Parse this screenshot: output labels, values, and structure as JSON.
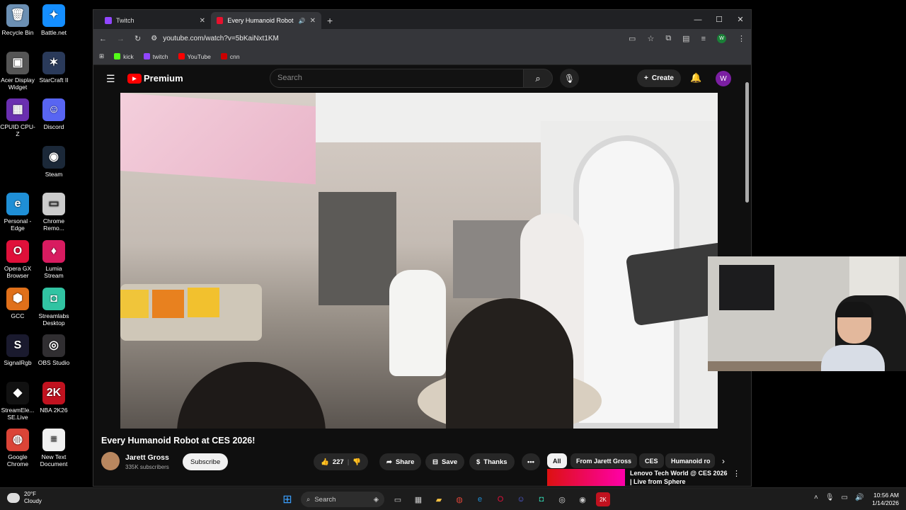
{
  "desktop": {
    "icons": [
      {
        "label": "Recycle Bin",
        "color": "#6b8fb3",
        "glyph": "🗑"
      },
      {
        "label": "Battle.net",
        "color": "#148eff",
        "glyph": "✦"
      },
      {
        "label": "Acer Display Widget",
        "color": "#555555",
        "glyph": "▣"
      },
      {
        "label": "StarCraft II",
        "color": "#2a3a5a",
        "glyph": "✶"
      },
      {
        "label": "CPUID CPU-Z",
        "color": "#6a2fb0",
        "glyph": "▦"
      },
      {
        "label": "Discord",
        "color": "#5865f2",
        "glyph": "☺"
      },
      {
        "label": "Steam",
        "color": "#1b2838",
        "glyph": "◉"
      },
      {
        "label": "Personal - Edge",
        "color": "#1f8fd6",
        "glyph": "e"
      },
      {
        "label": "Chrome Remo...",
        "color": "#cccccc",
        "glyph": "▭"
      },
      {
        "label": "Opera GX Browser",
        "color": "#e0103a",
        "glyph": "O"
      },
      {
        "label": "Lumia Stream",
        "color": "#d81b60",
        "glyph": "♦"
      },
      {
        "label": "GCC",
        "color": "#e0701a",
        "glyph": "⬢"
      },
      {
        "label": "Streamlabs Desktop",
        "color": "#31c3a2",
        "glyph": "◘"
      },
      {
        "label": "SignalRgb",
        "color": "#1a1a2e",
        "glyph": "S"
      },
      {
        "label": "OBS Studio",
        "color": "#302e31",
        "glyph": "◎"
      },
      {
        "label": "StreamEle... SE.Live",
        "color": "#111111",
        "glyph": "◆"
      },
      {
        "label": "NBA 2K26",
        "color": "#c1121f",
        "glyph": "2K"
      },
      {
        "label": "Google Chrome",
        "color": "#db4437",
        "glyph": "◍"
      },
      {
        "label": "New Text Document",
        "color": "#f0f0f0",
        "glyph": "≡"
      }
    ]
  },
  "browser": {
    "tabs": [
      {
        "label": "Twitch",
        "color": "#9146ff"
      },
      {
        "label": "Every Humanoid Robot at C",
        "color": "#e8112d"
      }
    ],
    "url": "youtube.com/watch?v=5bKaiNxt1KM",
    "bookmarks": [
      {
        "label": "kick",
        "color": "#53fc18"
      },
      {
        "label": "twitch",
        "color": "#9146ff"
      },
      {
        "label": "YouTube",
        "color": "#ff0000"
      },
      {
        "label": "cnn",
        "color": "#cc0000"
      }
    ],
    "profile_initial": "W"
  },
  "youtube": {
    "logo_text": "Premium",
    "search_placeholder": "Search",
    "create_label": "Create",
    "avatar_initial": "W",
    "video": {
      "title": "Every Humanoid Robot at CES 2026!",
      "channel": "Jarett Gross",
      "subscribers": "335K subscribers",
      "subscribe_label": "Subscribe",
      "likes": "227",
      "share_label": "Share",
      "save_label": "Save",
      "thanks_label": "Thanks"
    },
    "chips": [
      "All",
      "From Jarett Gross",
      "CES",
      "Humanoid ro"
    ],
    "recommended": {
      "title": "Lenovo Tech World @ CES 2026 | Live from Sphere"
    }
  },
  "taskbar": {
    "weather_temp": "20°F",
    "weather_desc": "Cloudy",
    "search_label": "Search",
    "time": "10:56 AM",
    "date": "1/14/2026"
  }
}
